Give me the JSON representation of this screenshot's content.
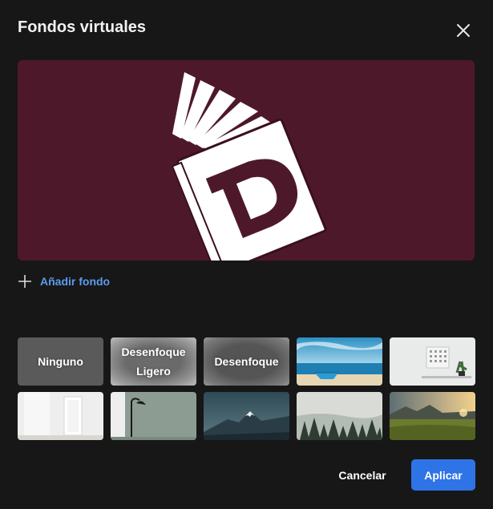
{
  "dialog": {
    "title": "Fondos virtuales",
    "close_icon": "close-icon"
  },
  "preview": {
    "logo_icon": "book-d-logo-icon",
    "background_color": "#4e182b"
  },
  "add_background": {
    "label": "Añadir fondo",
    "icon": "plus-icon"
  },
  "backgrounds": {
    "none_label": "Ninguno",
    "blur_light_label": "Desenfoque Ligero",
    "blur_label": "Desenfoque",
    "images": [
      "beach-boat-image",
      "white-room-plant-image",
      "white-doorway-image",
      "floor-lamp-image",
      "mountain-peaks-image",
      "misty-forest-image",
      "sunset-meadow-image"
    ]
  },
  "footer": {
    "cancel_label": "Cancelar",
    "apply_label": "Aplicar"
  },
  "colors": {
    "accent": "#2f74e6",
    "link": "#5b9bf0",
    "dialog_bg": "#171717"
  }
}
